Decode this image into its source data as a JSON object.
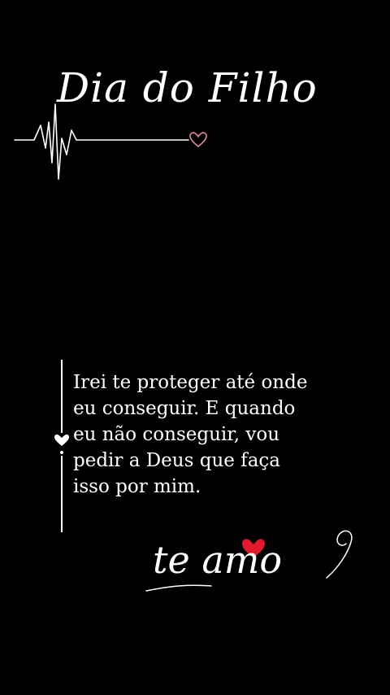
{
  "title": "Dia do Filho",
  "quote": {
    "lines": [
      "Irei te proteger até onde",
      "eu conseguir. E quando",
      "eu não conseguir, vou",
      "pedir a Deus que faça",
      "isso por mim."
    ]
  },
  "signature": "te amo",
  "colors": {
    "background": "#000000",
    "text": "#ffffff",
    "heart_red": "#e0192c",
    "heart_pink": "#e88aa0"
  },
  "icons": {
    "heartbeat": "heartbeat-line-icon",
    "small_heart": "heart-outline-icon",
    "red_heart": "heart-icon",
    "divider_heart": "heart-icon"
  }
}
